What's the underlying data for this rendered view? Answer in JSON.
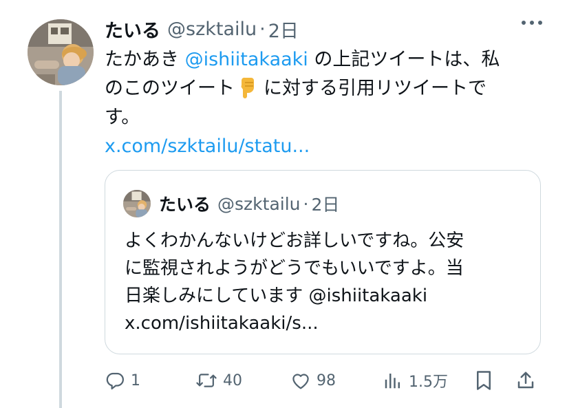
{
  "tweet": {
    "display_name": "たいる",
    "handle": "@szktailu",
    "dot": "·",
    "time": "2日",
    "body": {
      "line1_pre": "たかあき ",
      "mention": "@ishiitakaaki",
      "line1_post": " の上記ツイートは、私",
      "line2_pre": "のこのツイート",
      "line2_post": "に対する引用リツイートで",
      "line3": "す。",
      "link": "x.com/szktailu/statu..."
    },
    "emoji_icon": "backhand-index-pointing-down"
  },
  "quote": {
    "display_name": "たいる",
    "handle": "@szktailu",
    "dot": "·",
    "time": "2日",
    "lines": [
      "よくわかんないけどお詳しいですね。公安",
      "に監視されようがどうでもいいですよ。当",
      "日楽しみにしています @ishiitakaaki",
      "x.com/ishiitakaaki/s..."
    ]
  },
  "actions": {
    "reply_count": "1",
    "retweet_count": "40",
    "like_count": "98",
    "view_count": "1.5万"
  },
  "colors": {
    "text": "#0f1419",
    "secondary": "#536471",
    "link": "#1d9bf0",
    "border": "#cfd9de"
  }
}
